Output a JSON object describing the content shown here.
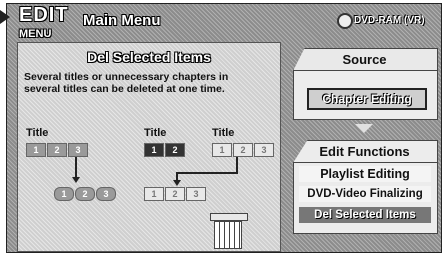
{
  "header": {
    "logo_big": "EDIT",
    "logo_small": "MENU",
    "title": "Main Menu",
    "disc_label": "DVD-RAM (VR)"
  },
  "left_panel": {
    "title": "Del Selected Items",
    "description": "Several titles or unnecessary chapters in several titles can be deleted at one time.",
    "title_labels": [
      "Title",
      "Title",
      "Title"
    ],
    "row1": {
      "group1": [
        "1",
        "2",
        "3"
      ],
      "group2": [
        "1",
        "2"
      ],
      "group3": [
        "1",
        "2",
        "3"
      ]
    },
    "row2": {
      "group1": [
        "1",
        "2",
        "3"
      ],
      "group2": [
        "1",
        "2",
        "3"
      ]
    }
  },
  "source": {
    "title": "Source",
    "button": "Chapter Editing"
  },
  "edit_functions": {
    "title": "Edit Functions",
    "options": [
      "Playlist Editing",
      "DVD-Video Finalizing",
      "Del Selected Items"
    ]
  }
}
